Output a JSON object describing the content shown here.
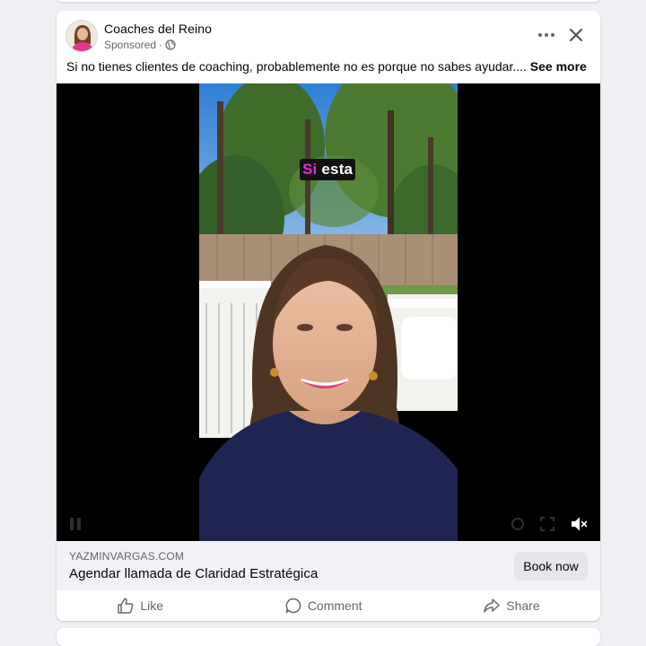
{
  "post": {
    "page_name": "Coaches del Reino",
    "sponsored_label": "Sponsored",
    "separator": " · ",
    "caption": "Si no tienes clientes de coaching, probablemente no es porque no sabes ayudar....",
    "see_more": "See more"
  },
  "video": {
    "subtitle_highlight": "Si",
    "subtitle_rest": " esta",
    "muted": true
  },
  "cta": {
    "domain": "YAZMINVARGAS.COM",
    "title": "Agendar llamada de Claridad Estratégica",
    "button": "Book now"
  },
  "actions": {
    "like": "Like",
    "comment": "Comment",
    "share": "Share"
  },
  "icons": {
    "more": "more-horizontal-icon",
    "close": "close-icon",
    "audience": "globe-icon",
    "mute": "volume-muted-icon",
    "like": "thumbs-up-icon",
    "comment": "comment-bubble-icon",
    "share": "share-arrow-icon"
  },
  "colors": {
    "text": "#050505",
    "secondary_text": "#65676b",
    "cta_bar": "#f0f2f5",
    "button": "#e4e6eb",
    "subtitle_highlight": "#e62ad7"
  }
}
